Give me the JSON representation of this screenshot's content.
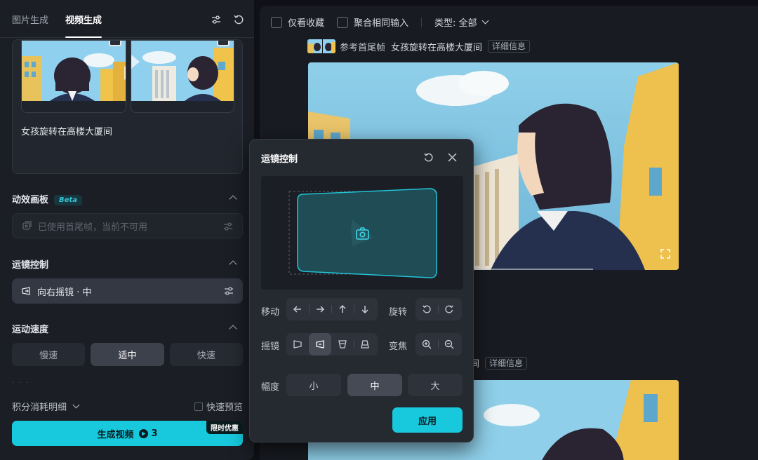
{
  "left": {
    "tabs": [
      "图片生成",
      "视频生成"
    ],
    "prompt_text": "女孩旋转在高楼大厦间",
    "motion_board": {
      "title": "动效画板",
      "badge": "Beta",
      "placeholder": "已使用首尾帧，当前不可用"
    },
    "camera": {
      "title": "运镜控制",
      "value": "向右摇镜 · 中"
    },
    "speed": {
      "title": "运动速度",
      "options": [
        "慢速",
        "适中",
        "快速"
      ],
      "selected": "适中"
    },
    "credit_label": "积分消耗明细",
    "fast_preview": "快速预览",
    "generate": {
      "label": "生成视频",
      "cost": "3",
      "promo": "限时优惠"
    }
  },
  "right": {
    "filters": {
      "favorites": "仅看收藏",
      "merge": "聚合相同输入",
      "type": "类型: 全部"
    },
    "item1": {
      "ref_label": "参考首尾帧",
      "prompt": "女孩旋转在高楼大厦间",
      "detail": "详细信息"
    },
    "item2": {
      "prompt_tail": "间",
      "detail": "详细信息"
    }
  },
  "modal": {
    "title": "运镜控制",
    "move_label": "移动",
    "rotate_label": "旋转",
    "pan_label": "摇镜",
    "zoom_label": "变焦",
    "amplitude_label": "幅度",
    "amplitude_options": [
      "小",
      "中",
      "大"
    ],
    "amplitude_selected": "中",
    "apply": "应用"
  },
  "colors": {
    "accent": "#18c9dd",
    "panel": "#1b1e25",
    "modal": "#252930"
  }
}
